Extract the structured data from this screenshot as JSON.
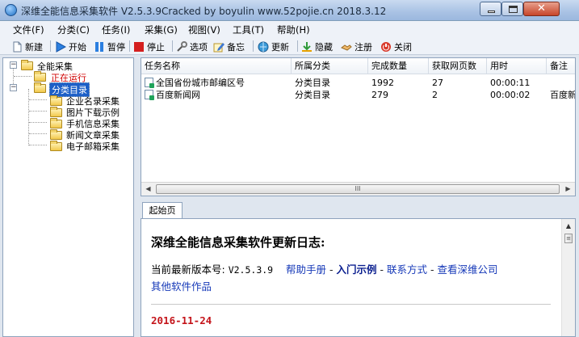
{
  "window": {
    "title": "深维全能信息采集软件 V2.5.3.9Cracked by boyulin www.52pojie.cn 2018.3.12",
    "minimize_icon": "minimize-icon",
    "maximize_icon": "maximize-icon",
    "close_glyph": "✕"
  },
  "menu": [
    "文件(F)",
    "分类(C)",
    "任务(I)",
    "采集(G)",
    "视图(V)",
    "工具(T)",
    "帮助(H)"
  ],
  "toolbar": {
    "new": "新建",
    "start": "开始",
    "pause": "暂停",
    "stop": "停止",
    "options": "选项",
    "memo": "备忘",
    "update": "更新",
    "hide": "隐藏",
    "register": "注册",
    "close": "关闭"
  },
  "tree": {
    "root": "全能采集",
    "running": "正在运行",
    "category": "分类目录",
    "children": [
      "企业名录采集",
      "图片下载示例",
      "手机信息采集",
      "新闻文章采集",
      "电子邮箱采集"
    ],
    "colors": {
      "running": "#d00000",
      "selected_bg": "#1c5fc7"
    }
  },
  "table": {
    "columns": [
      "任务名称",
      "所属分类",
      "完成数量",
      "获取网页数",
      "用时",
      "备注"
    ],
    "rows": [
      {
        "name": "全国省份城市邮编区号",
        "category": "分类目录",
        "done": "1992",
        "pages": "27",
        "time": "00:00:11",
        "note": ""
      },
      {
        "name": "百度新闻网",
        "category": "分类目录",
        "done": "279",
        "pages": "2",
        "time": "00:00:02",
        "note": "百度新"
      }
    ],
    "scroll_left": "◀",
    "scroll_right": "▶",
    "scroll_thumb": "III"
  },
  "panel": {
    "tab": "起始页",
    "title": "深维全能信息采集软件更新日志:",
    "version_prefix": "当前最新版本号:",
    "version": "V2.5.3.9",
    "links": {
      "help": "帮助手册",
      "intro": "入门示例",
      "contact": "联系方式",
      "company": "查看深维公司",
      "other": "其他软件作品"
    },
    "separator": "-",
    "date": "2016-11-24",
    "scroll_up": "▲",
    "scroll_thumb": "≡"
  }
}
